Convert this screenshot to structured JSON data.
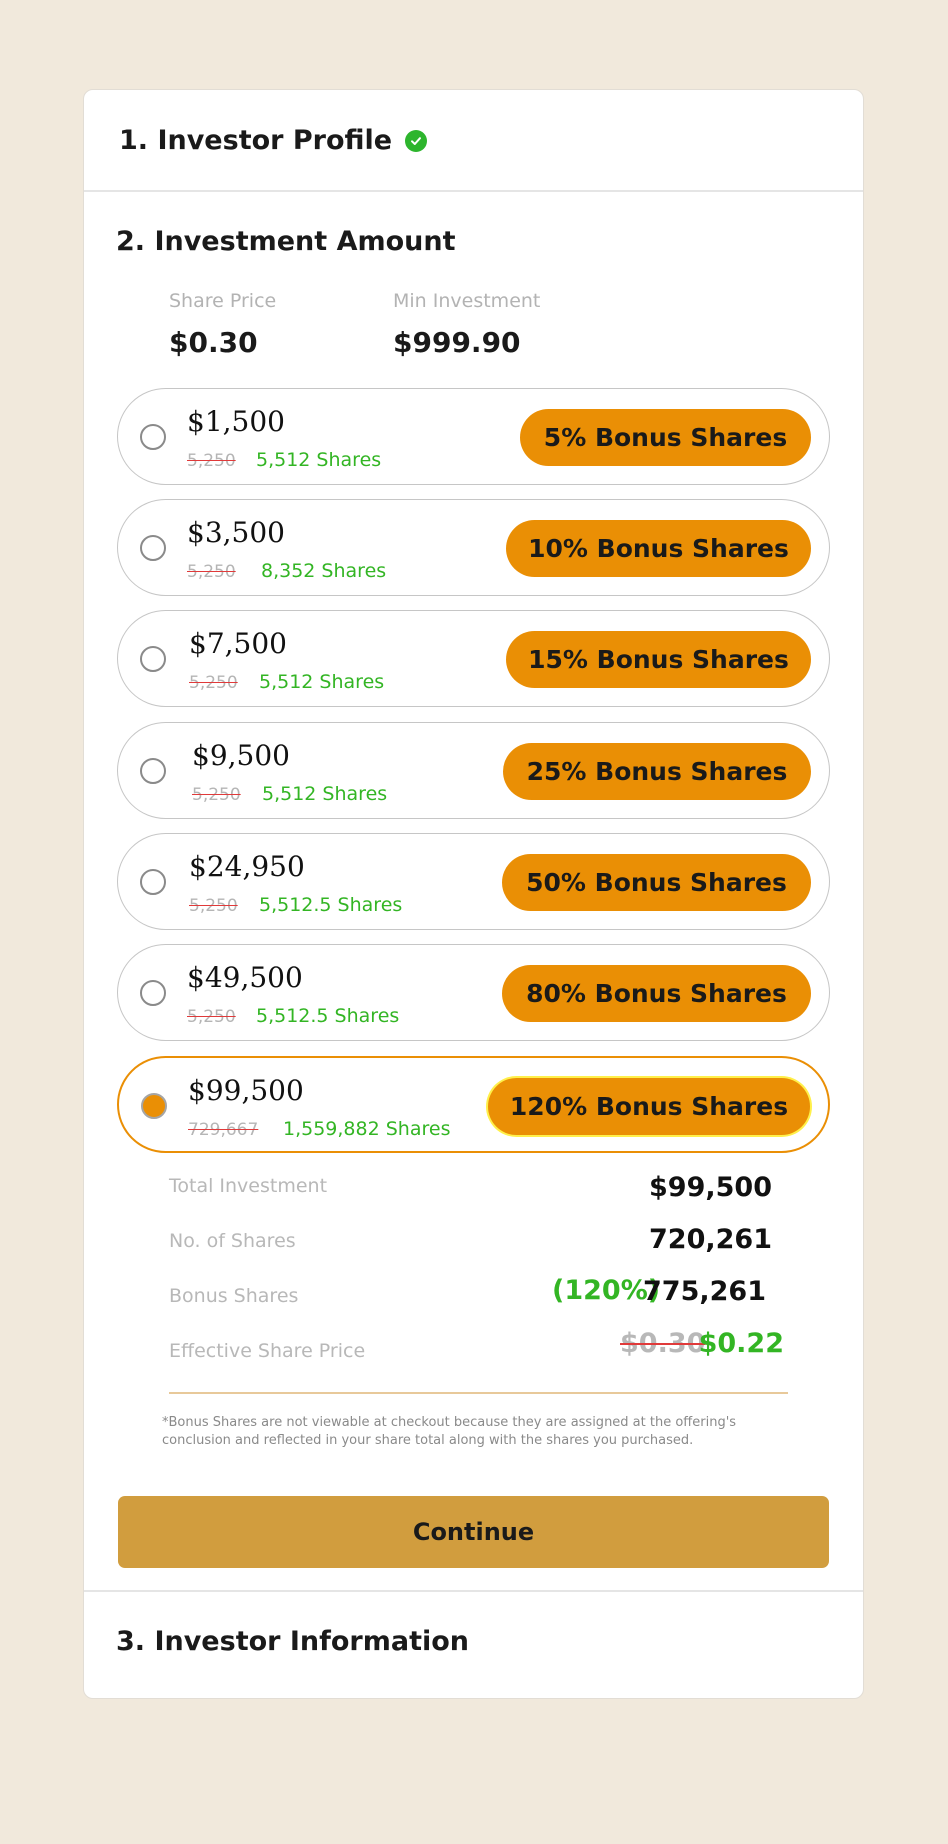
{
  "steps": {
    "step1_title": "1. Investor Profile",
    "step2_title": "2. Investment Amount",
    "step3_title": "3. Investor Information"
  },
  "meta": {
    "share_price_label": "Share Price",
    "share_price": "$0.30",
    "min_investment_label": "Min Investment",
    "min_investment": "$999.90"
  },
  "options": [
    {
      "amount": "$1,500",
      "old_shares": "5,250",
      "new_shares": "5,512 Shares",
      "bonus": "5% Bonus Shares",
      "selected": false
    },
    {
      "amount": "$3,500",
      "old_shares": "5,250",
      "new_shares": "8,352 Shares",
      "bonus": "10% Bonus Shares",
      "selected": false
    },
    {
      "amount": "$7,500",
      "old_shares": "5,250",
      "new_shares": "5,512 Shares",
      "bonus": "15% Bonus Shares",
      "selected": false
    },
    {
      "amount": "$9,500",
      "old_shares": "5,250",
      "new_shares": "5,512 Shares",
      "bonus": "25% Bonus Shares",
      "selected": false
    },
    {
      "amount": "$24,950",
      "old_shares": "5,250",
      "new_shares": "5,512.5 Shares",
      "bonus": "50% Bonus Shares",
      "selected": false
    },
    {
      "amount": "$49,500",
      "old_shares": "5,250",
      "new_shares": "5,512.5 Shares",
      "bonus": "80% Bonus Shares",
      "selected": false
    },
    {
      "amount": "$99,500",
      "old_shares": "729,667",
      "new_shares": "1,559,882 Shares",
      "bonus": "120% Bonus Shares",
      "selected": true
    }
  ],
  "summary": {
    "total_label": "Total Investment",
    "total_value": "$99,500",
    "shares_label": "No. of Shares",
    "shares_value": "720,261",
    "bonus_label": "Bonus Shares",
    "bonus_pct": "(120%)",
    "bonus_value": "775,261",
    "price_label": "Effective Share Price",
    "price_old": "$0.30",
    "price_new": "$0.22"
  },
  "footnote": "*Bonus Shares are not viewable at checkout because they are assigned at the offering's conclusion and reflected in your share total along with the shares you purchased.",
  "continue_label": "Continue",
  "colors": {
    "accent": "#ea8f05",
    "continue_button": "#d19d3e",
    "success_green": "#33b524",
    "background": "#f1e9dc"
  }
}
